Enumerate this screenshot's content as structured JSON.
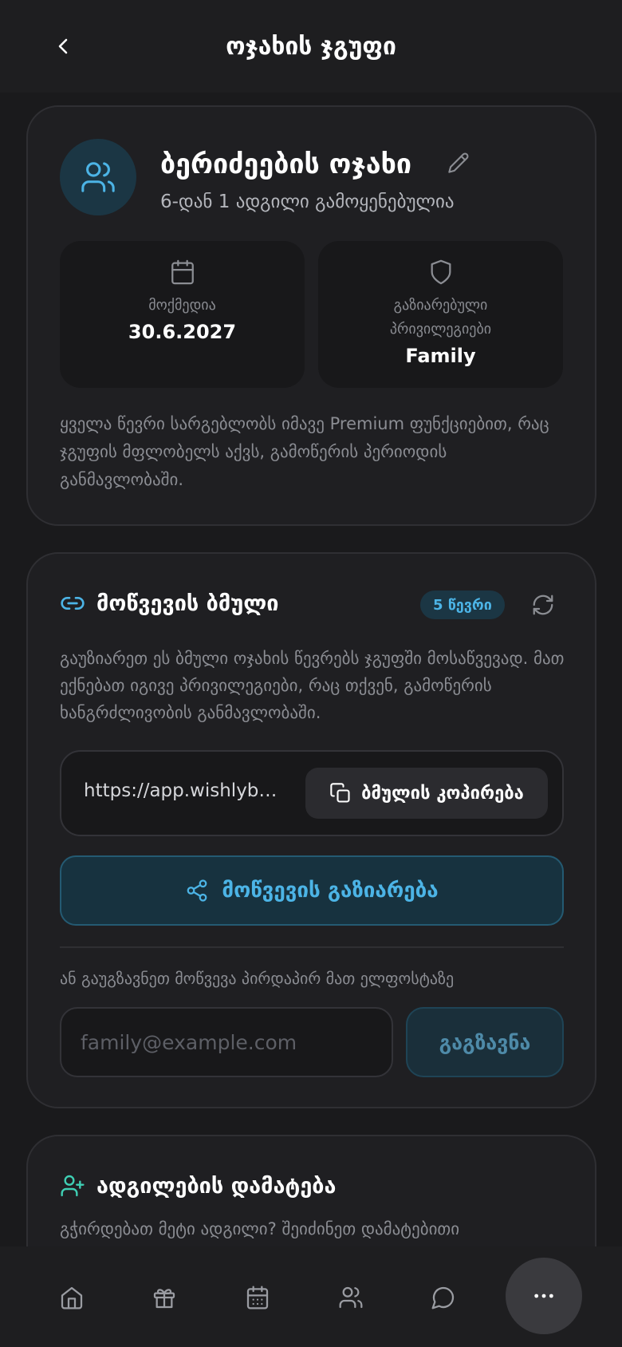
{
  "header": {
    "title": "ოჯახის ჯგუფი"
  },
  "group": {
    "name": "ბერიძეების ოჯახი",
    "seats_text": "6-დან 1 ადგილი გამოყენებულია",
    "validity_label": "მოქმედია",
    "validity_date": "30.6.2027",
    "privileges_label": "გაზიარებული პრივილეგიები",
    "privileges_value": "Family",
    "description": "ყველა წევრი სარგებლობს იმავე Premium ფუნქციებით, რაც ჯგუფის მფლობელს აქვს, გამოწერის პერიოდის განმავლობაში."
  },
  "invite": {
    "title": "მოწვევის ბმული",
    "member_badge": "5 წევრი",
    "description": "გაუზიარეთ ეს ბმული ოჯახის წევრებს ჯგუფში მოსაწვევად. მათ ექნებათ იგივე პრივილეგიები, რაც თქვენ, გამოწერის ხანგრძლივობის განმავლობაში.",
    "link_url": "https://app.wishlybo...",
    "copy_label": "ბმულის კოპირება",
    "share_label": "მოწვევის გაზიარება",
    "or_text": "ან გაუგზავნეთ მოწვევა პირდაპირ მათ ელფოსტაზე",
    "email_placeholder": "family@example.com",
    "send_label": "გაგზავნა"
  },
  "seats": {
    "title": "ადგილების დამატება",
    "description": "გჭირდებათ მეტი ადგილი? შეიძინეთ დამატებითი"
  },
  "colors": {
    "background": "#1a1a1c",
    "card": "#1f1f22",
    "accent": "#4cb4e6",
    "accent_green": "#3fcfb4"
  },
  "tabbar": {
    "icons": [
      "home-icon",
      "gift-icon",
      "calendar-icon",
      "users-icon",
      "chat-icon",
      "more-icon"
    ]
  }
}
